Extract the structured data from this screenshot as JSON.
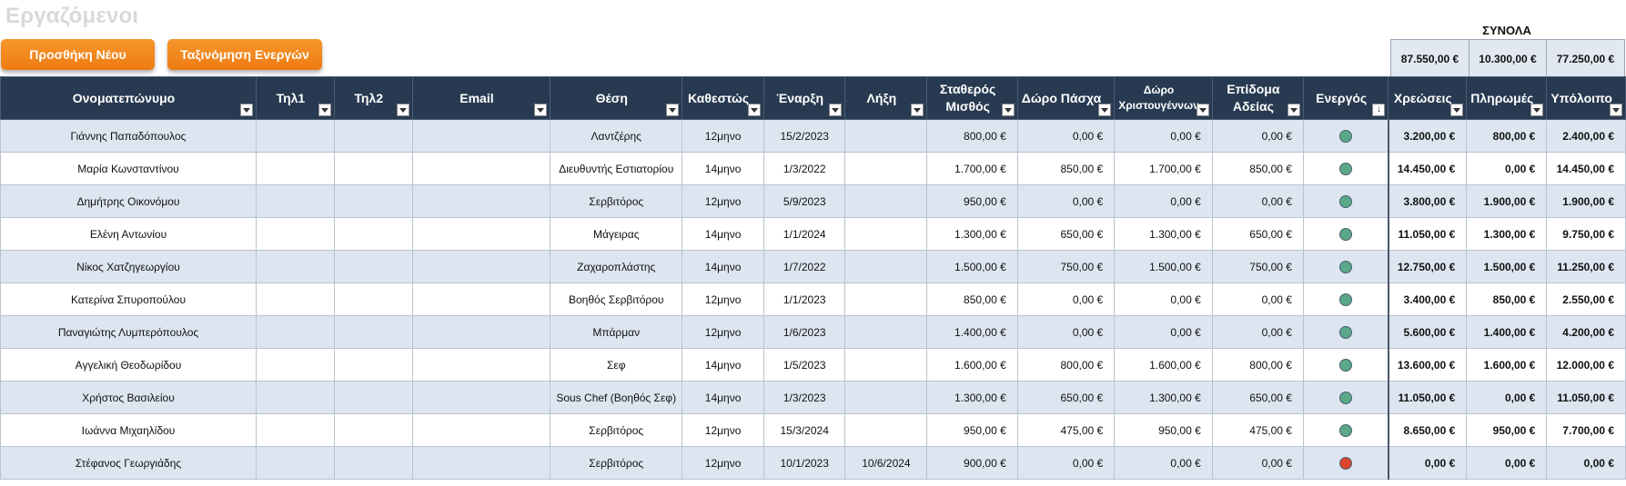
{
  "sheet_title": "Εργαζόμενοι",
  "buttons": {
    "add": "Προσθήκη Νέου",
    "sort": "Ταξινόμηση Ενεργών"
  },
  "totals": {
    "label": "ΣΥΝΟΛΑ",
    "charges": "87.550,00 €",
    "payments": "10.300,00 €",
    "balance": "77.250,00 €"
  },
  "colors": {
    "header_bg": "#283a51",
    "button": "#f08414",
    "active": "#5aa887",
    "inactive": "#d9462c",
    "row_alt": "#dde6f0"
  },
  "headers": {
    "name": "Ονοματεπώνυμο",
    "tel1": "Τηλ1",
    "tel2": "Τηλ2",
    "email": "Email",
    "position": "Θέση",
    "status": "Καθεστώς",
    "start": "Έναρξη",
    "end": "Λήξη",
    "salary_1": "Σταθερός",
    "salary_2": "Μισθός",
    "easter": "Δώρο Πάσχα",
    "xmas_1": "Δώρο",
    "xmas_2": "Χριστουγέννων",
    "leave_1": "Επίδομα",
    "leave_2": "Αδείας",
    "active": "Ενεργός",
    "charges": "Χρεώσεις",
    "payments": "Πληρωμές",
    "balance": "Υπόλοιπο"
  },
  "rows": [
    {
      "name": "Γιάννης Παπαδόπουλος",
      "tel1": "",
      "tel2": "",
      "email": "",
      "position": "Λαντζέρης",
      "status": "12μηνο",
      "start": "15/2/2023",
      "end": "",
      "salary": "800,00 €",
      "easter": "0,00 €",
      "xmas": "0,00 €",
      "leave": "0,00 €",
      "active": true,
      "charges": "3.200,00 €",
      "payments": "800,00 €",
      "balance": "2.400,00 €"
    },
    {
      "name": "Μαρία Κωνσταντίνου",
      "tel1": "",
      "tel2": "",
      "email": "",
      "position": "Διευθυντής Εστιατορίου",
      "status": "14μηνο",
      "start": "1/3/2022",
      "end": "",
      "salary": "1.700,00 €",
      "easter": "850,00 €",
      "xmas": "1.700,00 €",
      "leave": "850,00 €",
      "active": true,
      "charges": "14.450,00 €",
      "payments": "0,00 €",
      "balance": "14.450,00 €"
    },
    {
      "name": "Δημήτρης Οικονόμου",
      "tel1": "",
      "tel2": "",
      "email": "",
      "position": "Σερβιτόρος",
      "status": "12μηνο",
      "start": "5/9/2023",
      "end": "",
      "salary": "950,00 €",
      "easter": "0,00 €",
      "xmas": "0,00 €",
      "leave": "0,00 €",
      "active": true,
      "charges": "3.800,00 €",
      "payments": "1.900,00 €",
      "balance": "1.900,00 €"
    },
    {
      "name": "Ελένη Αντωνίου",
      "tel1": "",
      "tel2": "",
      "email": "",
      "position": "Μάγειρας",
      "status": "14μηνο",
      "start": "1/1/2024",
      "end": "",
      "salary": "1.300,00 €",
      "easter": "650,00 €",
      "xmas": "1.300,00 €",
      "leave": "650,00 €",
      "active": true,
      "charges": "11.050,00 €",
      "payments": "1.300,00 €",
      "balance": "9.750,00 €"
    },
    {
      "name": "Νίκος Χατζηγεωργίου",
      "tel1": "",
      "tel2": "",
      "email": "",
      "position": "Ζαχαροπλάστης",
      "status": "14μηνο",
      "start": "1/7/2022",
      "end": "",
      "salary": "1.500,00 €",
      "easter": "750,00 €",
      "xmas": "1.500,00 €",
      "leave": "750,00 €",
      "active": true,
      "charges": "12.750,00 €",
      "payments": "1.500,00 €",
      "balance": "11.250,00 €"
    },
    {
      "name": "Κατερίνα Σπυροπούλου",
      "tel1": "",
      "tel2": "",
      "email": "",
      "position": "Βοηθός Σερβιτόρου",
      "status": "12μηνο",
      "start": "1/1/2023",
      "end": "",
      "salary": "850,00 €",
      "easter": "0,00 €",
      "xmas": "0,00 €",
      "leave": "0,00 €",
      "active": true,
      "charges": "3.400,00 €",
      "payments": "850,00 €",
      "balance": "2.550,00 €"
    },
    {
      "name": "Παναγιώτης Λυμπερόπουλος",
      "tel1": "",
      "tel2": "",
      "email": "",
      "position": "Μπάρμαν",
      "status": "12μηνο",
      "start": "1/6/2023",
      "end": "",
      "salary": "1.400,00 €",
      "easter": "0,00 €",
      "xmas": "0,00 €",
      "leave": "0,00 €",
      "active": true,
      "charges": "5.600,00 €",
      "payments": "1.400,00 €",
      "balance": "4.200,00 €"
    },
    {
      "name": "Αγγελική Θεοδωρίδου",
      "tel1": "",
      "tel2": "",
      "email": "",
      "position": "Σεφ",
      "status": "14μηνο",
      "start": "1/5/2023",
      "end": "",
      "salary": "1.600,00 €",
      "easter": "800,00 €",
      "xmas": "1.600,00 €",
      "leave": "800,00 €",
      "active": true,
      "charges": "13.600,00 €",
      "payments": "1.600,00 €",
      "balance": "12.000,00 €"
    },
    {
      "name": "Χρήστος Βασιλείου",
      "tel1": "",
      "tel2": "",
      "email": "",
      "position": "Sous Chef (Βοηθός Σεφ)",
      "status": "14μηνο",
      "start": "1/3/2023",
      "end": "",
      "salary": "1.300,00 €",
      "easter": "650,00 €",
      "xmas": "1.300,00 €",
      "leave": "650,00 €",
      "active": true,
      "charges": "11.050,00 €",
      "payments": "0,00 €",
      "balance": "11.050,00 €"
    },
    {
      "name": "Ιωάννα Μιχαηλίδου",
      "tel1": "",
      "tel2": "",
      "email": "",
      "position": "Σερβιτόρος",
      "status": "12μηνο",
      "start": "15/3/2024",
      "end": "",
      "salary": "950,00 €",
      "easter": "475,00 €",
      "xmas": "950,00 €",
      "leave": "475,00 €",
      "active": true,
      "charges": "8.650,00 €",
      "payments": "950,00 €",
      "balance": "7.700,00 €"
    },
    {
      "name": "Στέφανος Γεωργιάδης",
      "tel1": "",
      "tel2": "",
      "email": "",
      "position": "Σερβιτόρος",
      "status": "12μηνο",
      "start": "10/1/2023",
      "end": "10/6/2024",
      "salary": "900,00 €",
      "easter": "0,00 €",
      "xmas": "0,00 €",
      "leave": "0,00 €",
      "active": false,
      "charges": "0,00 €",
      "payments": "0,00 €",
      "balance": "0,00 €"
    }
  ]
}
